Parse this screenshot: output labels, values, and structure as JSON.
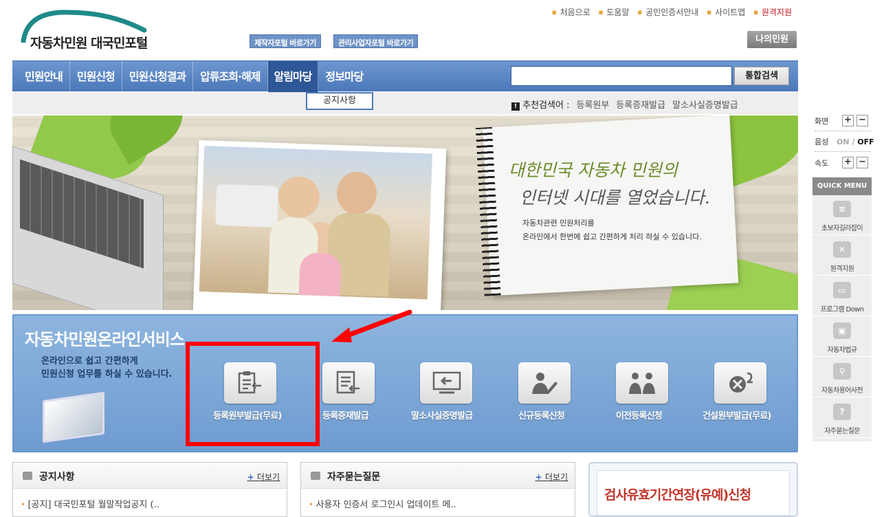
{
  "header": {
    "logo_text": "자동차민원 대국민포털",
    "portal_buttons": [
      "제작자포털 바로가기",
      "관리사업자포털 바로가기"
    ],
    "util_links": [
      "처음으로",
      "도움말",
      "공인인증서안내",
      "사이트맵",
      "원격지원"
    ],
    "my_button": "나의민원"
  },
  "nav": {
    "items": [
      "민원안내",
      "민원신청",
      "민원신청결과",
      "압류조회·해제",
      "알림마당",
      "정보마당"
    ],
    "active_index": 4,
    "dropdown_item": "공지사항",
    "search_button": "통합검색",
    "recommend_label": "추천검색어 :",
    "recommend_terms": [
      "등록원부",
      "등록증재발급",
      "말소사실증명발급"
    ]
  },
  "banner": {
    "headline_1": "대한민국 자동차 민원의",
    "headline_2": "인터넷 시대를 열었습니다.",
    "sub_1": "자동차관련 민원처리를",
    "sub_2": "온라인에서 한번에 쉽고 간편하게 처리 하실 수 있습니다."
  },
  "services": {
    "title": "자동차민원온라인서비스",
    "desc_1": "온라인으로 쉽고 간편하게",
    "desc_2": "민원신청 업무를 하실 수 있습니다.",
    "items": [
      {
        "label": "등록원부발급(무료)",
        "icon": "clipboard-icon"
      },
      {
        "label": "등록증재발급",
        "icon": "document-arrow-icon"
      },
      {
        "label": "말소사실증명발급",
        "icon": "monitor-arrow-icon"
      },
      {
        "label": "신규등록신청",
        "icon": "person-pen-icon"
      },
      {
        "label": "이전등록신청",
        "icon": "people-transfer-icon"
      },
      {
        "label": "건설원부발급(무료)",
        "icon": "wrench-document-icon"
      }
    ]
  },
  "notice": {
    "title": "공지사항",
    "more": "더보기",
    "first": "[공지] 대국민포털 월말작업공지 (.."
  },
  "faq": {
    "title": "자주묻는질문",
    "more": "더보기",
    "first": "사용자 인증서 로그인시 업데이트 메.."
  },
  "promo": {
    "text": "검사유효기간연장(유예)신청"
  },
  "sidebar": {
    "screen_label": "화면",
    "voice_label": "음성",
    "voice_on": "ON /",
    "voice_off": "OFF",
    "speed_label": "속도",
    "plus": "+",
    "minus": "−",
    "quick_menu_title": "QUICK MENU",
    "quick_items": [
      "초보자길라잡이",
      "원격지원",
      "프로그램 Down",
      "자동차법규",
      "자동차용어사전",
      "자주묻는질문"
    ]
  },
  "colors": {
    "nav": "#4c78ba",
    "accent_red": "#ff0000",
    "service_panel": "#7aa6d8"
  }
}
